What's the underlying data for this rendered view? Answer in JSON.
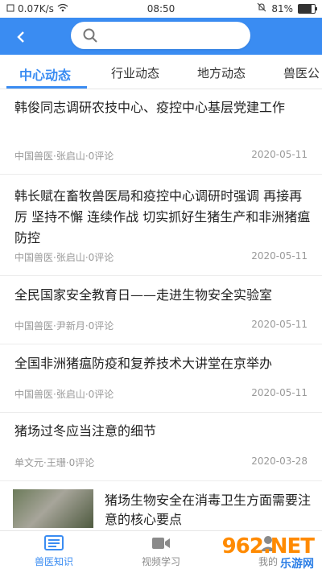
{
  "status_bar": {
    "speed": "0.07K/s",
    "time": "08:50",
    "battery": "81%"
  },
  "search": {
    "placeholder": "",
    "value": ""
  },
  "tabs": [
    {
      "label": "中心动态",
      "active": true
    },
    {
      "label": "行业动态"
    },
    {
      "label": "地方动态"
    },
    {
      "label": "兽医公"
    }
  ],
  "news": [
    {
      "title": "韩俊同志调研农技中心、疫控中心基层党建工作",
      "meta": "中国兽医·张启山·0评论",
      "date": "2020-05-11"
    },
    {
      "title": "韩长赋在畜牧兽医局和疫控中心调研时强调 再接再厉 坚持不懈 连续作战 切实抓好生猪生产和非洲猪瘟防控",
      "meta": "中国兽医·张启山·0评论",
      "date": "2020-05-11"
    },
    {
      "title": "全民国家安全教育日——走进生物安全实验室",
      "meta": "中国兽医·尹新月·0评论",
      "date": "2020-05-11"
    },
    {
      "title": "全国非洲猪瘟防疫和复养技术大讲堂在京举办",
      "meta": "中国兽医·张启山·0评论",
      "date": "2020-05-11"
    },
    {
      "title": "猪场过冬应当注意的细节",
      "meta": "单文元·王珊·0评论",
      "date": "2020-03-28"
    },
    {
      "title": "猪场生物安全在消毒卫生方面需要注意的核心要点",
      "meta": "",
      "date": ""
    }
  ],
  "bottom_nav": [
    {
      "label": "兽医知识",
      "icon": "book-icon",
      "active": true
    },
    {
      "label": "视频学习",
      "icon": "video-icon"
    },
    {
      "label": "我的",
      "icon": "user-icon"
    }
  ],
  "watermark": {
    "num": "962.NET",
    "sub": "乐游网"
  },
  "colors": {
    "accent": "#3a8cf2",
    "meta": "#999999"
  }
}
